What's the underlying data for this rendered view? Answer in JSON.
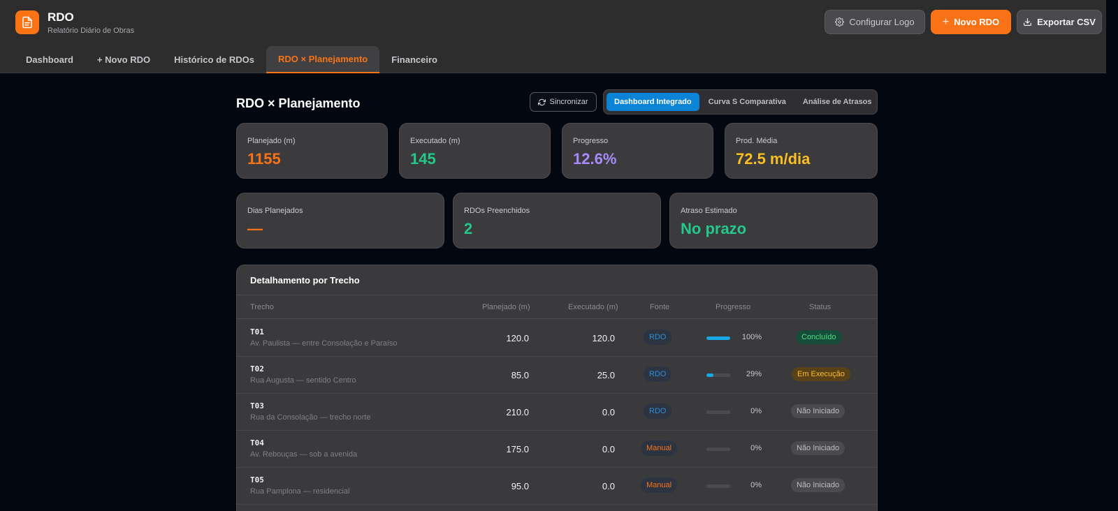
{
  "app": {
    "title": "RDO",
    "subtitle": "Relatório Diário de Obras"
  },
  "header_buttons": {
    "config_logo": "Configurar Logo",
    "new_rdo": "Novo RDO",
    "export_csv": "Exportar CSV"
  },
  "tabs": [
    {
      "label": "Dashboard"
    },
    {
      "label": "+ Novo RDO"
    },
    {
      "label": "Histórico de RDOs"
    },
    {
      "label": "RDO × Planejamento",
      "active": true
    },
    {
      "label": "Financeiro"
    }
  ],
  "page": {
    "title": "RDO × Planejamento",
    "sync_label": "Sincronizar",
    "segments": [
      {
        "label": "Dashboard Integrado",
        "active": true
      },
      {
        "label": "Curva S Comparativa"
      },
      {
        "label": "Análise de Atrasos"
      }
    ]
  },
  "kpi_row1": [
    {
      "label": "Planejado (m)",
      "value": "1155",
      "color": "#f97316"
    },
    {
      "label": "Executado (m)",
      "value": "145",
      "color": "#22c98a"
    },
    {
      "label": "Progresso",
      "value": "12.6%",
      "color": "#a78bfa"
    },
    {
      "label": "Prod. Média",
      "value": "72.5 m/dia",
      "color": "#fbbf24"
    }
  ],
  "kpi_row2": [
    {
      "label": "Dias Planejados",
      "value": "—",
      "color": "#f97316"
    },
    {
      "label": "RDOs Preenchidos",
      "value": "2",
      "color": "#22c98a"
    },
    {
      "label": "Atraso Estimado",
      "value": "No prazo",
      "color": "#22c98a"
    }
  ],
  "table": {
    "title": "Detalhamento por Trecho",
    "headers": {
      "trecho": "Trecho",
      "planejado": "Planejado (m)",
      "executado": "Executado (m)",
      "fonte": "Fonte",
      "progresso": "Progresso",
      "status": "Status"
    },
    "rows": [
      {
        "code": "T01",
        "desc": "Av. Paulista — entre Consolação e Paraíso",
        "planejado": "120.0",
        "executado": "120.0",
        "fonte": "RDO",
        "progress": 100,
        "pct": "100%",
        "status": "Concluído",
        "status_type": "done"
      },
      {
        "code": "T02",
        "desc": "Rua Augusta — sentido Centro",
        "planejado": "85.0",
        "executado": "25.0",
        "fonte": "RDO",
        "progress": 29,
        "pct": "29%",
        "status": "Em Execução",
        "status_type": "exec"
      },
      {
        "code": "T03",
        "desc": "Rua da Consolação — trecho norte",
        "planejado": "210.0",
        "executado": "0.0",
        "fonte": "RDO",
        "progress": 0,
        "pct": "0%",
        "status": "Não Iniciado",
        "status_type": "none"
      },
      {
        "code": "T04",
        "desc": "Av. Rebouças — sob a avenida",
        "planejado": "175.0",
        "executado": "0.0",
        "fonte": "Manual",
        "progress": 0,
        "pct": "0%",
        "status": "Não Iniciado",
        "status_type": "none"
      },
      {
        "code": "T05",
        "desc": "Rua Pamplona — residencial",
        "planejado": "95.0",
        "executado": "0.0",
        "fonte": "Manual",
        "progress": 0,
        "pct": "0%",
        "status": "Não Iniciado",
        "status_type": "none"
      }
    ]
  }
}
